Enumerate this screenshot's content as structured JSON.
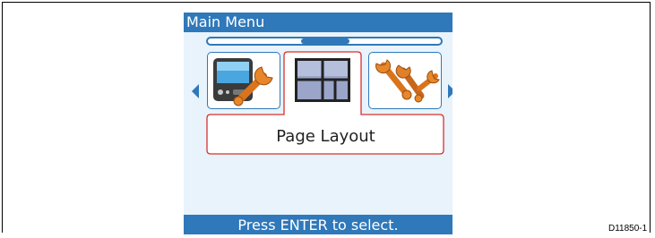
{
  "window": {
    "title": "Main Menu"
  },
  "menu": {
    "items": [
      {
        "icon": "display-wrench-icon"
      },
      {
        "icon": "page-layout-icon",
        "selected": true
      },
      {
        "icon": "wrenches-icon"
      }
    ],
    "selected_label": "Page Layout"
  },
  "status": {
    "prompt": "Press ENTER to select."
  },
  "figure": {
    "code": "D11850-1"
  },
  "colors": {
    "accent": "#2f78ba",
    "highlight": "#d9302b",
    "background": "#e8f3fb"
  }
}
